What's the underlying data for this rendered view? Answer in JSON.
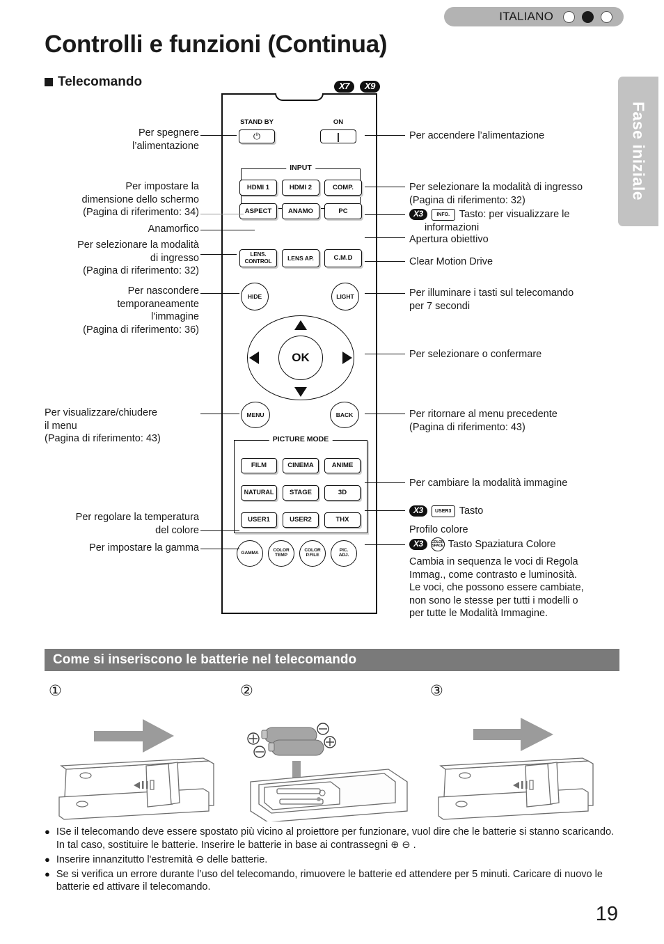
{
  "header": {
    "language": "ITALIANO",
    "indicator_dots": [
      "open",
      "filled",
      "open"
    ]
  },
  "page_title": "Controlli e funzioni (Continua)",
  "section_heading": "Telecomando",
  "side_tab": "Fase iniziale",
  "page_number": "19",
  "model_badges": [
    "X7",
    "X9"
  ],
  "remote": {
    "labels": {
      "stand_by": "STAND BY",
      "on": "ON",
      "input_group": "INPUT",
      "picture_mode_group": "PICTURE MODE"
    },
    "buttons": {
      "standby": "⏻",
      "on": "|",
      "hdmi1": "HDMI 1",
      "hdmi2": "HDMI 2",
      "comp": "COMP.",
      "aspect": "ASPECT",
      "anamo": "ANAMO",
      "pc": "PC",
      "lens_control": "LENS.\nCONTROL",
      "lens_ap": "LENS AP.",
      "cmd": "C.M.D",
      "hide": "HIDE",
      "light": "LIGHT",
      "ok": "OK",
      "menu": "MENU",
      "back": "BACK",
      "film": "FILM",
      "cinema": "CINEMA",
      "anime": "ANIME",
      "natural": "NATURAL",
      "stage": "STAGE",
      "three_d": "3D",
      "user1": "USER1",
      "user2": "USER2",
      "thx": "THX",
      "gamma": "GAMMA",
      "color_temp": "COLOR\nTEMP",
      "color_pfile": "COLOR\nP.FILE",
      "pic_adj": "PIC.\nADJ."
    }
  },
  "callouts_left": [
    {
      "id": "standby",
      "lines": [
        "Per spegnere",
        "l’alimentazione"
      ]
    },
    {
      "id": "aspect",
      "lines": [
        "Per impostare la",
        "dimensione dello schermo",
        "(Pagina di riferimento: 34)"
      ]
    },
    {
      "id": "anamo",
      "lines": [
        "Anamorfico"
      ]
    },
    {
      "id": "lens-control",
      "lines": [
        "Per selezionare la modalità",
        "di ingresso",
        "(Pagina di riferimento: 32)"
      ]
    },
    {
      "id": "hide",
      "lines": [
        "Per nascondere",
        "temporaneamente",
        "l'immagine",
        "(Pagina di riferimento: 36)"
      ]
    },
    {
      "id": "menu",
      "lines": [
        "Per visualizzare/chiudere",
        "il menu",
        "(Pagina di riferimento: 43)"
      ]
    },
    {
      "id": "color-temp",
      "lines": [
        "Per regolare la temperatura",
        "del colore"
      ]
    },
    {
      "id": "gamma",
      "lines": [
        "Per impostare la gamma"
      ]
    }
  ],
  "callouts_right": [
    {
      "id": "on",
      "lines": [
        "Per accendere l’alimentazione"
      ]
    },
    {
      "id": "comp",
      "lines": [
        "Per selezionare la modalità di ingresso",
        "(Pagina di riferimento: 32)"
      ]
    },
    {
      "id": "pc-info",
      "badge": "X3",
      "key": "INFO.",
      "lines": [
        "Tasto: per visualizzare le",
        "informazioni"
      ]
    },
    {
      "id": "lens-ap",
      "lines": [
        "Apertura obiettivo"
      ]
    },
    {
      "id": "cmd",
      "lines": [
        "Clear Motion Drive"
      ]
    },
    {
      "id": "light",
      "lines": [
        "Per illuminare i tasti sul telecomando",
        "per 7 secondi"
      ]
    },
    {
      "id": "ok",
      "lines": [
        "Per selezionare o confermare"
      ]
    },
    {
      "id": "back",
      "lines": [
        "Per ritornare al menu precedente",
        "(Pagina di riferimento: 43)"
      ]
    },
    {
      "id": "picture-mode",
      "lines": [
        "Per cambiare la modalità immagine"
      ]
    },
    {
      "id": "thx-user",
      "badge": "X3",
      "key": "USER3",
      "lines": [
        "Tasto"
      ]
    },
    {
      "id": "color-pfile",
      "lines": [
        "Profilo colore"
      ]
    },
    {
      "id": "color-space",
      "badge": "X3",
      "key": "COLOR SPACE",
      "lines": [
        "Tasto Spaziatura Colore"
      ]
    },
    {
      "id": "pic-adj",
      "lines": [
        "Cambia in sequenza le voci di Regola",
        "Immag., come contrasto e luminosità.",
        "Le voci, che possono essere cambiate,",
        "non sono le stesse per tutti i modelli o",
        "per tutte le Modalità Immagine."
      ]
    }
  ],
  "battery": {
    "heading": "Come si inseriscono le batterie nel telecomando",
    "steps": [
      "①",
      "②",
      "③"
    ],
    "polarity": {
      "plus": "⊕",
      "minus": "⊖"
    },
    "notes": [
      "ISe il telecomando deve essere spostato più vicino al proiettore per funzionare, vuol dire che le batterie si stanno scaricando. In tal caso, sostituire le batterie. Inserire le batterie in base ai contrassegni ⊕ ⊖ .",
      "Inserire innanzitutto l'estremità ⊖ delle batterie.",
      "Se si verifica un errore durante l’uso del telecomando, rimuovere le batterie ed attendere per 5 minuti. Caricare di nuovo le batterie ed attivare il telecomando."
    ]
  },
  "colors": {
    "header_bar": "#b3b3b3",
    "side_tab": "#c2c2c2",
    "section_bar": "#7a7a7a",
    "ink": "#1a1a1a",
    "arrow_grey": "#9b9b9b"
  }
}
